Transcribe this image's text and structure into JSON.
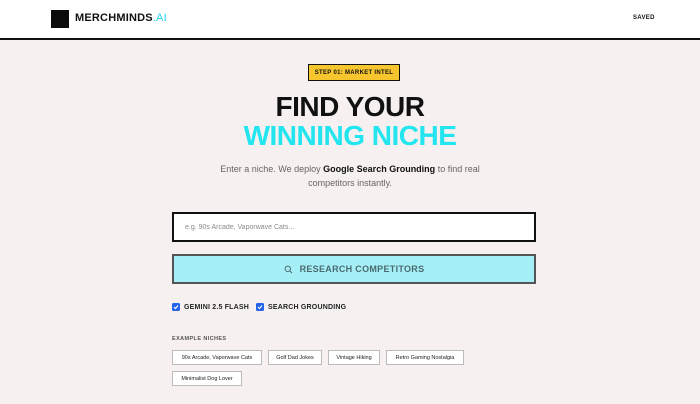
{
  "header": {
    "brand_main": "MERCHMINDS",
    "brand_suffix": ".AI",
    "saved_label": "SAVED"
  },
  "hero": {
    "step_badge": "STEP 01: MARKET INTEL",
    "title_line1": "FIND YOUR",
    "title_line2": "WINNING NICHE",
    "subtitle_before": "Enter a niche. We deploy ",
    "subtitle_bold": "Google Search Grounding",
    "subtitle_after": " to find real competitors instantly."
  },
  "search": {
    "placeholder": "e.g. 90s Arcade, Vaporwave Cats...",
    "value": "",
    "button_label": "RESEARCH COMPETITORS"
  },
  "options": [
    {
      "label": "GEMINI 2.5 FLASH",
      "checked": true
    },
    {
      "label": "SEARCH GROUNDING",
      "checked": true
    }
  ],
  "examples": {
    "label": "EXAMPLE NICHES",
    "items": [
      "90s Arcade, Vaporwave Cats",
      "Golf Dad Jokes",
      "Vintage Hiking",
      "Retro Gaming Nostalgia",
      "Minimalist Dog Lover"
    ]
  },
  "colors": {
    "accent_cyan": "#22e5f0",
    "badge_yellow": "#f7c62f",
    "button_bg": "#a5f0f6",
    "checkbox_blue": "#2563eb"
  }
}
